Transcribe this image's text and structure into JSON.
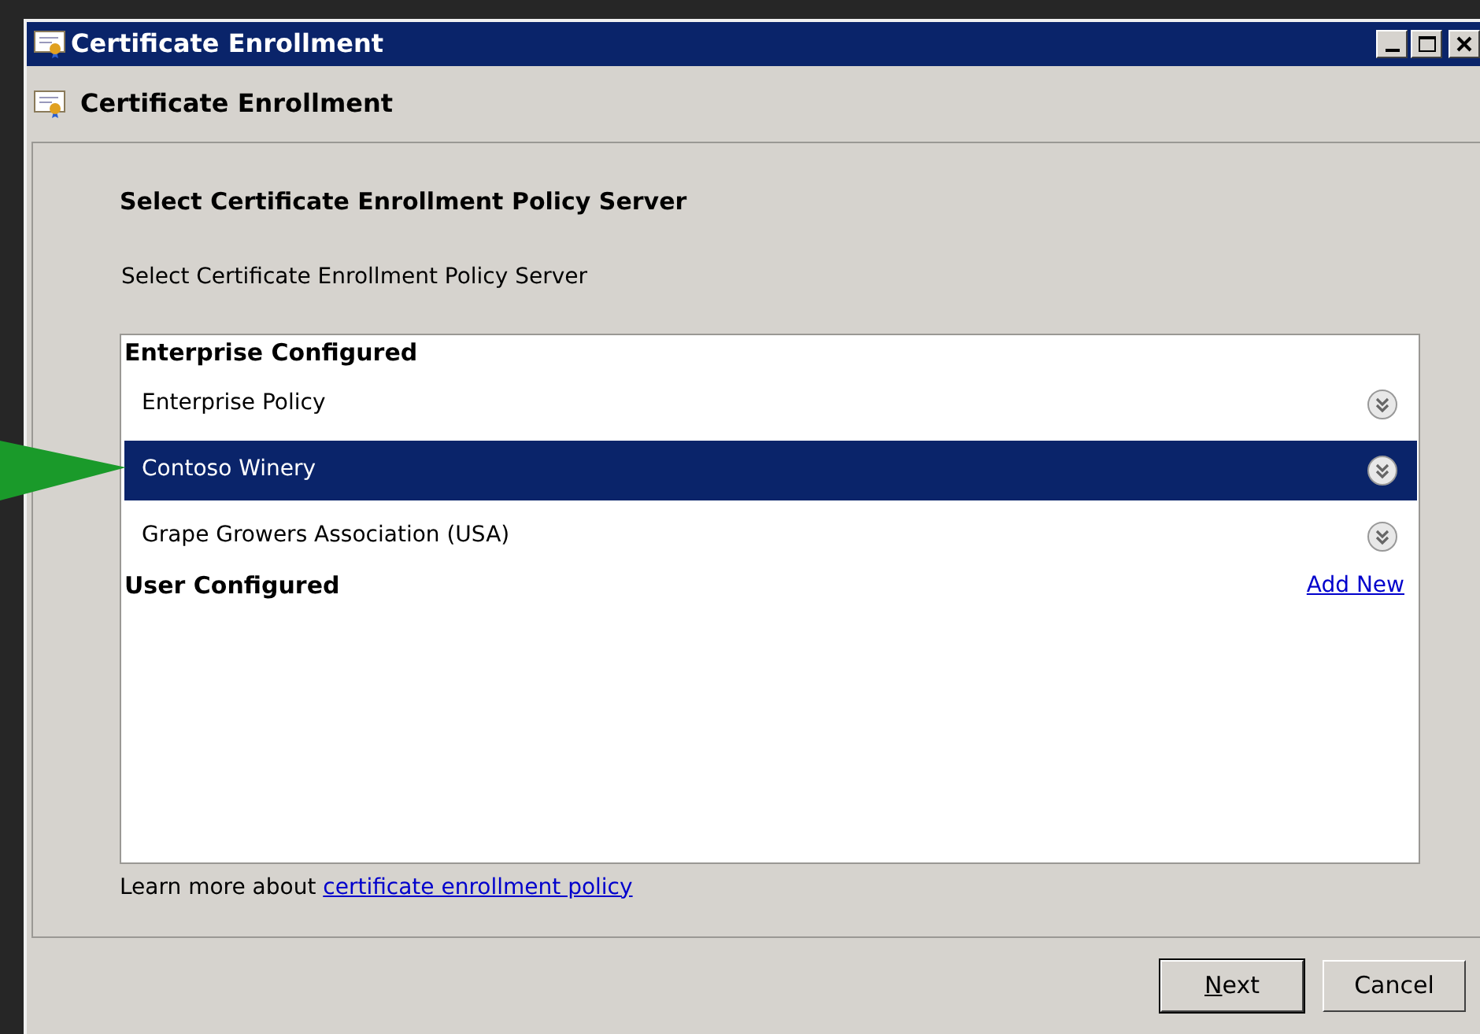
{
  "window": {
    "title": "Certificate Enrollment"
  },
  "header": {
    "title": "Certificate Enrollment"
  },
  "page": {
    "heading": "Select Certificate Enrollment Policy Server",
    "description": "Select Certificate Enrollment Policy Server"
  },
  "sections": [
    {
      "title": "Enterprise Configured",
      "items": [
        {
          "label": "Enterprise Policy",
          "selected": false
        },
        {
          "label": "Contoso Winery",
          "selected": true
        },
        {
          "label": "Grape Growers Association (USA)",
          "selected": false
        }
      ]
    },
    {
      "title": "User Configured",
      "link": "Add New"
    }
  ],
  "footer": {
    "text": "Learn more about",
    "link": "certificate enrollment policy"
  },
  "buttons": [
    {
      "label": "Next",
      "default": true
    },
    {
      "label": "Cancel",
      "default": false
    }
  ]
}
